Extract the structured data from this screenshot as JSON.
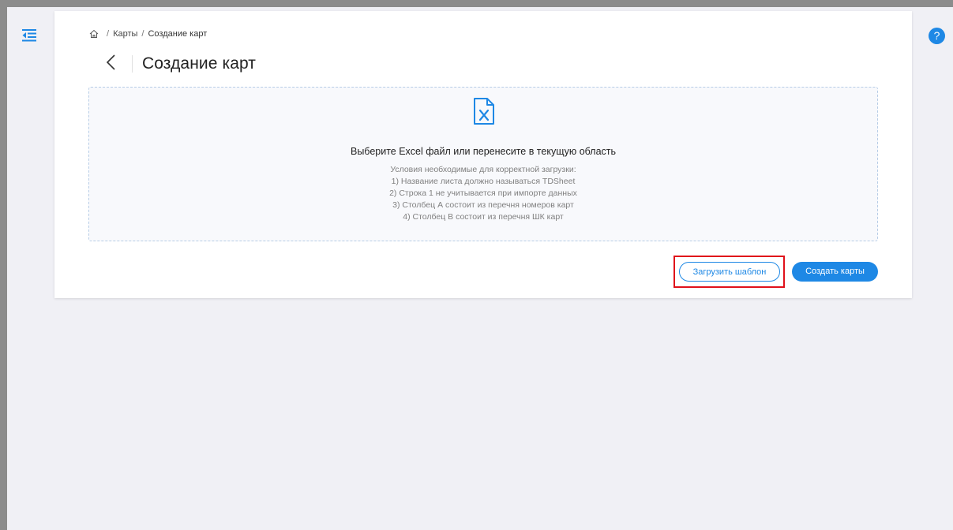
{
  "breadcrumb": {
    "home_icon": "home-icon",
    "items": [
      "Карты",
      "Создание карт"
    ],
    "separator": "/"
  },
  "header": {
    "back_icon": "chevron-left-icon",
    "title": "Создание карт"
  },
  "dropzone": {
    "icon": "excel-file-icon",
    "title": "Выберите Excel файл или перенесите в текущую область",
    "conditions": [
      "Условия необходимые для корректной загрузки:",
      "1) Название листа должно называться TDSheet",
      "2) Строка 1 не учитывается при импорте данных",
      "3) Столбец А состоит из перечня номеров карт",
      "4) Столбец В состоит из перечня ШК карт"
    ]
  },
  "actions": {
    "download_template_label": "Загрузить шаблон",
    "create_cards_label": "Создать карты"
  },
  "help": {
    "label": "?"
  },
  "colors": {
    "accent": "#1e88e5",
    "highlight": "#e0101a",
    "background": "#f0f0f5"
  }
}
